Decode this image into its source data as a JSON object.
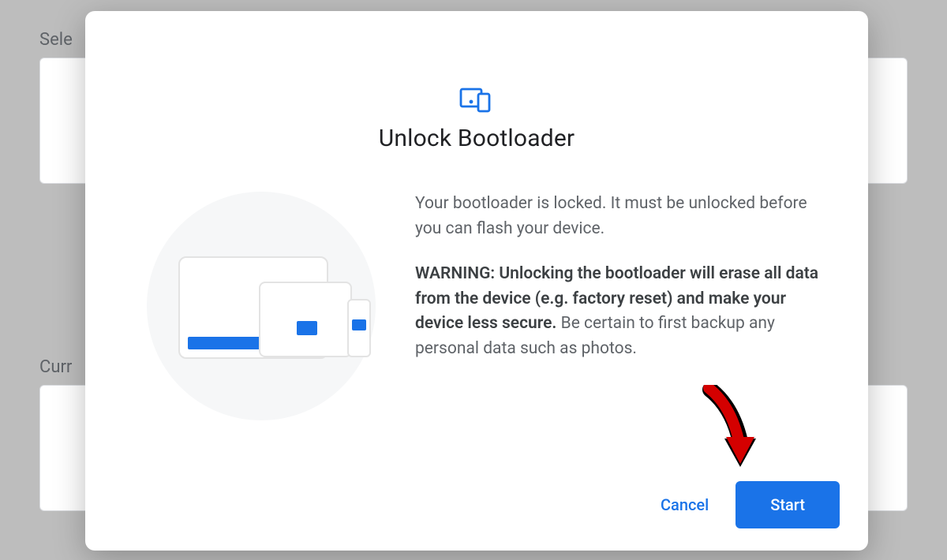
{
  "background": {
    "label1_partial": "Sele",
    "label2_partial": "Curr"
  },
  "dialog": {
    "title": "Unlock Bootloader",
    "description": "Your bootloader is locked. It must be unlocked before you can flash your device.",
    "warning_bold": "WARNING: Unlocking the bootloader will erase all data from the device (e.g. factory reset) and make your device less secure.",
    "warning_rest": " Be certain to first backup any personal data such as photos.",
    "cancel_label": "Cancel",
    "start_label": "Start"
  }
}
